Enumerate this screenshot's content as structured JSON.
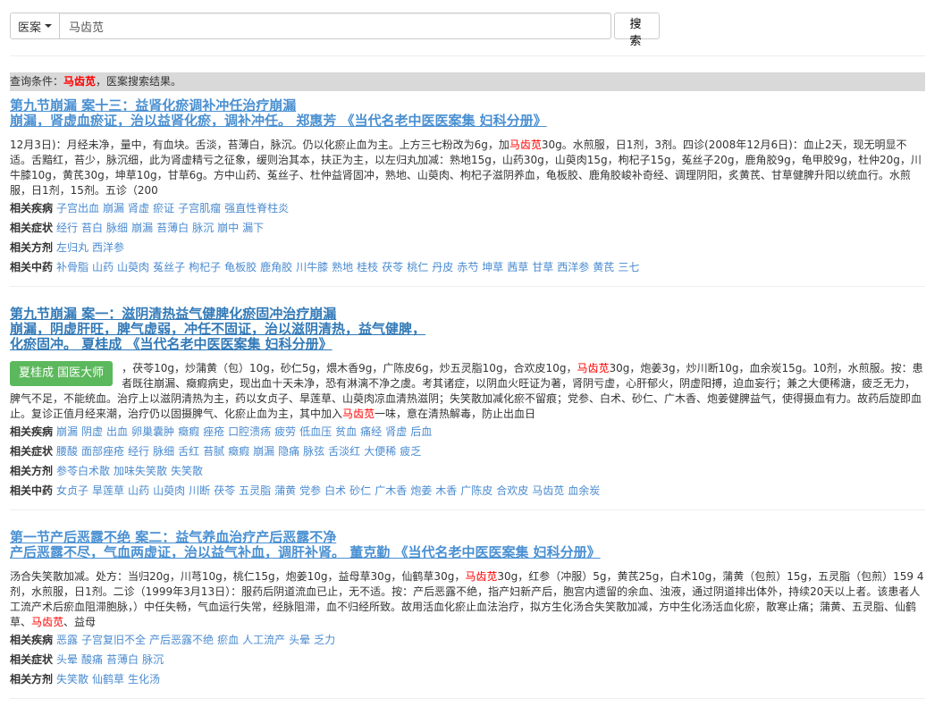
{
  "search": {
    "category": "医案",
    "query": "马齿苋",
    "button": "搜 索"
  },
  "condition": {
    "prefix": "查询条件：",
    "keyword": "马齿苋",
    "suffix": "，医案搜索结果。"
  },
  "tag_labels": {
    "diseases": "相关疾病",
    "symptoms": "相关症状",
    "formulas": "相关方剂",
    "herbs": "相关中药"
  },
  "results": [
    {
      "title": [
        "第九节崩漏 案十三：益肾化瘀调补冲任治疗崩漏",
        "崩漏，肾虚血瘀证，治以益肾化瘀，调补冲任。 郑惠芳 《当代名老中医医案集 妇科分册》"
      ],
      "badge": null,
      "body": [
        {
          "t": "12月3日)：月经未净，量中，有血块。舌淡，苔薄白，脉沉。仍以化瘀止血为主。上方三七粉改为6g，加"
        },
        {
          "t": "马齿苋",
          "hl": true
        },
        {
          "t": "30g。水煎服，日1剂，3剂。四诊(2008年12月6日)：血止2天，现无明显不适。舌黯红，苔少，脉沉细，此为肾虚精亏之征象，缓则治其本，扶正为主，以左归丸加减：熟地15g，山药30g，山萸肉15g，枸杞子15g，菟丝子20g，鹿角胶9g，龟甲胶9g，杜仲20g，川牛膝10g，黄芪30g，坤草10g，甘草6g。方中山药、菟丝子、杜仲益肾固冲，熟地、山萸肉、枸杞子滋阴养血，龟板胶、鹿角胶峻补奇经、调理阴阳，炙黄芪、甘草健脾升阳以统血行。水煎服，日1剂，15剂。五诊（200"
        }
      ],
      "diseases": [
        "子宫出血",
        "崩漏",
        "肾虚",
        "瘀证",
        "子宫肌瘤",
        "强直性脊柱炎"
      ],
      "symptoms": [
        "经行",
        "苔白",
        "脉细",
        "崩漏",
        "苔薄白",
        "脉沉",
        "崩中",
        "漏下"
      ],
      "formulas": [
        "左归丸",
        "西洋参"
      ],
      "herbs": [
        "补骨脂",
        "山药",
        "山萸肉",
        "菟丝子",
        "枸杞子",
        "龟板胶",
        "鹿角胶",
        "川牛膝",
        "熟地",
        "桂枝",
        "茯苓",
        "桃仁",
        "丹皮",
        "赤芍",
        "坤草",
        "茜草",
        "甘草",
        "西洋参",
        "黄芪",
        "三七"
      ]
    },
    {
      "title": [
        "第九节崩漏 案一：滋阴清热益气健脾化瘀固冲治疗崩漏",
        "崩漏，阴虚肝旺，脾气虚弱，冲任不固证，治以滋阴清热，益气健脾，",
        "化瘀固冲。 夏桂成 《当代名老中医医案集 妇科分册》"
      ],
      "badge": "夏桂成 国医大师",
      "body": [
        {
          "t": "，茯苓10g，炒蒲黄（包）10g，砂仁5g，煨木香9g，广陈皮6g，炒五灵脂10g，合欢皮10g，"
        },
        {
          "t": "马齿苋",
          "hl": true
        },
        {
          "t": "30g，炮姜3g，炒川断10g，血余炭15g。10剂，水煎服。按：患者既往崩漏、癥瘕病史，现出血十天未净，恐有淋漓不净之虞。考其诸症，以阴血火旺证为著，肾阴亏虚，心肝郁火，阴虚阳搏，迫血妄行；兼之大便稀溏，疲乏无力，脾气不足，不能统血。治疗上以滋阴清热为主，药以女贞子、旱莲草、山萸肉凉血清热滋阴；失笑散加减化瘀不留痕；党参、白术、砂仁、广木香、炮姜健脾益气，使得摄血有力。故药后旋即血止。复诊正值月经来潮，治疗仍以固摄脾气、化瘀止血为主，其中加入"
        },
        {
          "t": "马齿苋",
          "hl": true
        },
        {
          "t": "一味，意在清热解毒，防止出血日"
        }
      ],
      "diseases": [
        "崩漏",
        "阴虚",
        "出血",
        "卵巢囊肿",
        "癥瘕",
        "痤疮",
        "口腔溃疡",
        "疲劳",
        "低血压",
        "贫血",
        "痛经",
        "肾虚",
        "后血"
      ],
      "symptoms": [
        "腰酸",
        "面部痤疮",
        "经行",
        "脉细",
        "舌红",
        "苔腻",
        "癥瘕",
        "崩漏",
        "隐痛",
        "脉弦",
        "舌淡红",
        "大便稀",
        "疲乏"
      ],
      "formulas": [
        "参苓白术散",
        "加味失笑散",
        "失笑散"
      ],
      "herbs": [
        "女贞子",
        "旱莲草",
        "山药",
        "山萸肉",
        "川断",
        "茯苓",
        "五灵脂",
        "蒲黄",
        "党参",
        "白术",
        "砂仁",
        "广木香",
        "炮姜",
        "木香",
        "广陈皮",
        "合欢皮",
        "马齿苋",
        "血余炭"
      ]
    },
    {
      "title": [
        "第一节产后恶露不绝 案二：益气养血治疗产后恶露不净",
        "产后恶露不尽，气血两虚证，治以益气补血，调肝补肾。 董克勤 《当代名老中医医案集 妇科分册》"
      ],
      "badge": null,
      "body": [
        {
          "t": "汤合失笑散加减。处方：当归20g，川芎10g，桃仁15g，炮姜10g，益母草30g，仙鹤草30g，"
        },
        {
          "t": "马齿苋",
          "hl": true
        },
        {
          "t": "30g，红参（冲服）5g，黄芪25g，白术10g，蒲黄（包煎）15g，五灵脂（包煎）159 4剂，水煎服，日1剂。二诊（1999年3月13日）：服药后阴道流血已止，无不适。按：产后恶露不绝，指产妇新产后，胞宫内遗留的余血、浊液，通过阴道排出体外，持续20天以上者。该患者人工流产术后瘀血阻滞胞脉，）中任失畅，气血运行失常，经脉阻滞，血不归经所致。故用活血化瘀止血法治疗，拟方生化汤合失笑散加减，方中生化汤活血化瘀，散寒止痛；蒲黄、五灵脂、仙鹤草、"
        },
        {
          "t": "马齿苋",
          "hl": true
        },
        {
          "t": "、益母"
        }
      ],
      "diseases": [
        "恶露",
        "子宫复旧不全",
        "产后恶露不绝",
        "瘀血",
        "人工流产",
        "头晕",
        "乏力"
      ],
      "symptoms": [
        "头晕",
        "酸痛",
        "苔薄白",
        "脉沉"
      ],
      "formulas": [
        "失笑散",
        "仙鹤草",
        "生化汤"
      ],
      "herbs": []
    }
  ]
}
